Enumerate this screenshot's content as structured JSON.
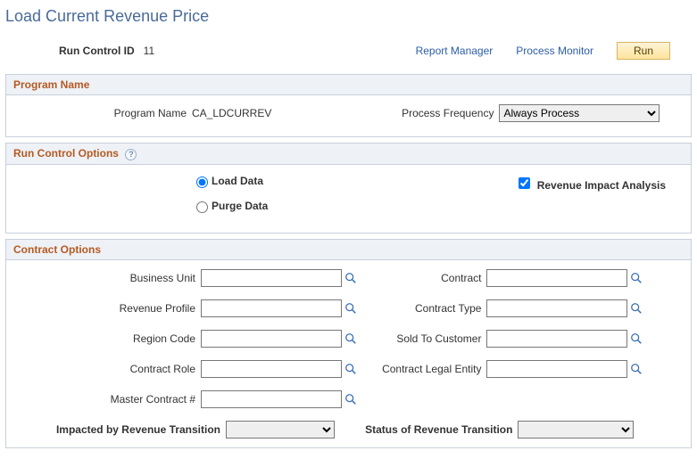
{
  "page_title": "Load Current Revenue Price",
  "top": {
    "run_control_label": "Run Control ID",
    "run_control_value": "11",
    "report_manager": "Report Manager",
    "process_monitor": "Process Monitor",
    "run_button": "Run"
  },
  "program": {
    "header": "Program Name",
    "name_label": "Program Name",
    "name_value": "CA_LDCURREV",
    "freq_label": "Process Frequency",
    "freq_value": "Always Process"
  },
  "run_options": {
    "header": "Run Control Options",
    "load_data": "Load Data",
    "purge_data": "Purge Data",
    "revenue_impact": "Revenue Impact Analysis"
  },
  "contract": {
    "header": "Contract Options",
    "left": [
      {
        "label": "Business Unit",
        "value": ""
      },
      {
        "label": "Revenue Profile",
        "value": ""
      },
      {
        "label": "Region Code",
        "value": ""
      },
      {
        "label": "Contract Role",
        "value": ""
      },
      {
        "label": "Master Contract #",
        "value": ""
      }
    ],
    "right": [
      {
        "label": "Contract",
        "value": ""
      },
      {
        "label": "Contract Type",
        "value": ""
      },
      {
        "label": "Sold To Customer",
        "value": ""
      },
      {
        "label": "Contract Legal Entity",
        "value": ""
      }
    ],
    "impacted_label": "Impacted by Revenue Transition",
    "impacted_value": "",
    "status_label": "Status of Revenue Transition",
    "status_value": ""
  }
}
